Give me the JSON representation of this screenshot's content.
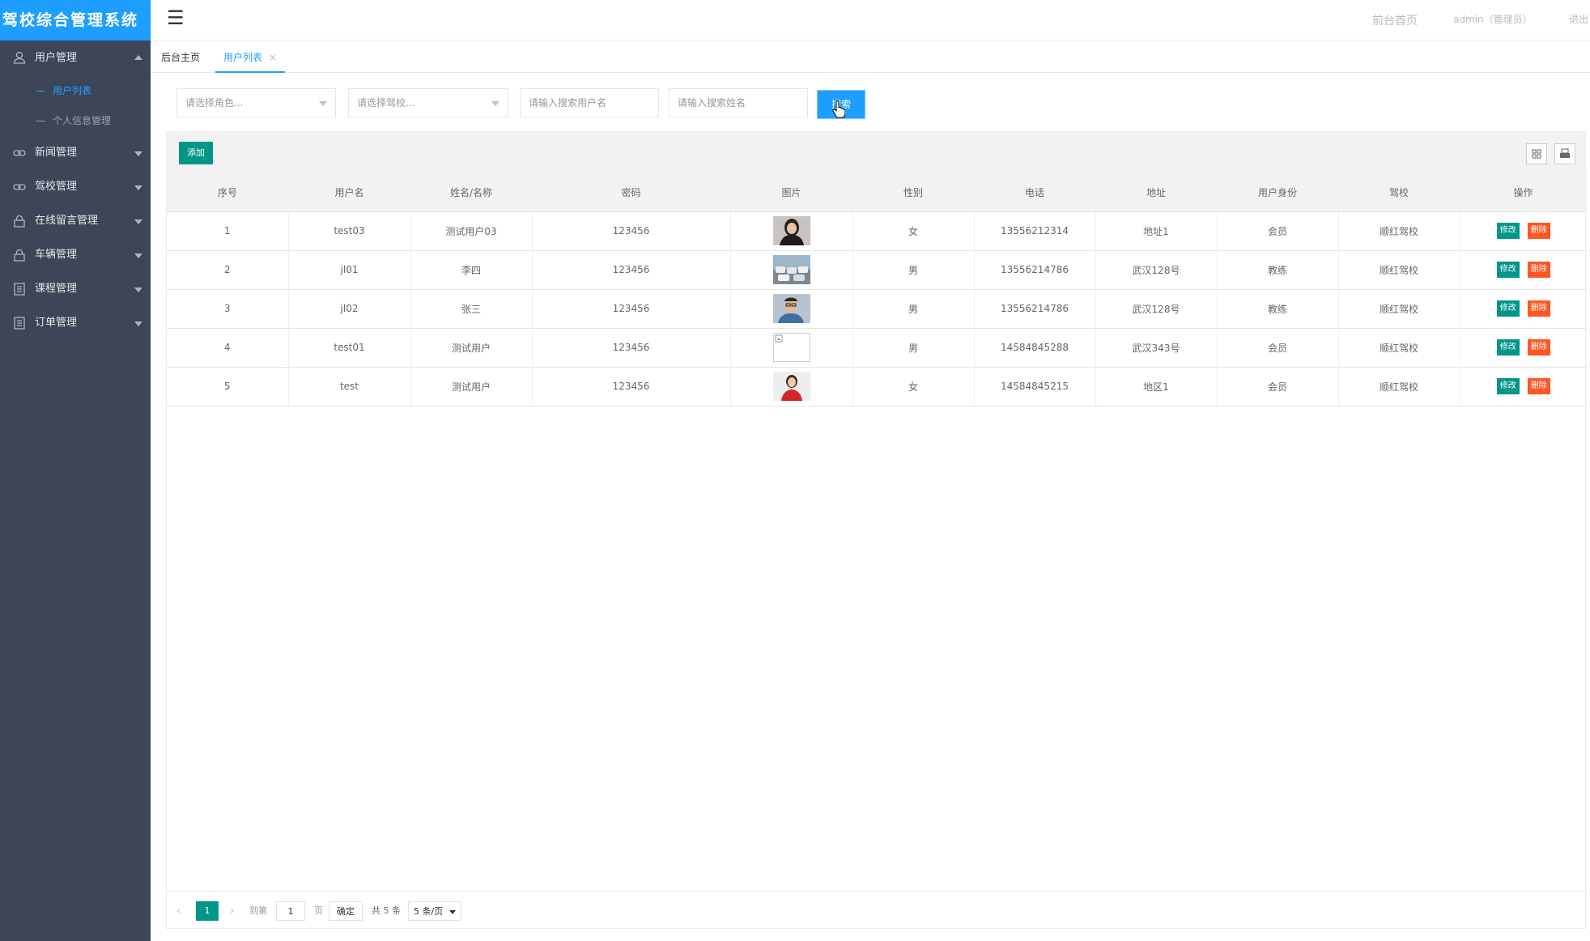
{
  "app": {
    "title": "驾校综合管理系统"
  },
  "sidebar": {
    "items": [
      {
        "label": "用户管理",
        "icon": "user-icon",
        "open": true,
        "children": [
          {
            "label": "用户列表",
            "active": true
          },
          {
            "label": "个人信息管理",
            "active": false
          }
        ]
      },
      {
        "label": "新闻管理",
        "icon": "link-icon"
      },
      {
        "label": "驾校管理",
        "icon": "link-icon"
      },
      {
        "label": "在线留言管理",
        "icon": "lock-icon"
      },
      {
        "label": "车辆管理",
        "icon": "lock-icon"
      },
      {
        "label": "课程管理",
        "icon": "document-icon"
      },
      {
        "label": "订单管理",
        "icon": "document-icon"
      }
    ]
  },
  "topbar": {
    "front_home": "前台首页",
    "user": "admin（管理员）",
    "logout": "退出"
  },
  "tabs": [
    {
      "label": "后台主页",
      "active": false
    },
    {
      "label": "用户列表",
      "active": true,
      "close": "×"
    }
  ],
  "filters": {
    "role_placeholder": "请选择角色...",
    "school_placeholder": "请选择驾校...",
    "username_placeholder": "请输入搜索用户名",
    "name_placeholder": "请输入搜索姓名",
    "search_label": "搜索"
  },
  "table": {
    "add_label": "添加",
    "columns": [
      "序号",
      "用户名",
      "姓名/名称",
      "密码",
      "图片",
      "性别",
      "电话",
      "地址",
      "用户身份",
      "驾校",
      "操作"
    ],
    "rows": [
      {
        "no": "1",
        "username": "test03",
        "name": "测试用户03",
        "password": "123456",
        "photo": "portrait-woman-dark",
        "gender": "女",
        "phone": "13556212314",
        "address": "地址1",
        "role": "会员",
        "school": "顺红驾校"
      },
      {
        "no": "2",
        "username": "jl01",
        "name": "李四",
        "password": "123456",
        "photo": "cars-lot",
        "gender": "男",
        "phone": "13556214786",
        "address": "武汉128号",
        "role": "教练",
        "school": "顺红驾校"
      },
      {
        "no": "3",
        "username": "jl02",
        "name": "张三",
        "password": "123456",
        "photo": "portrait-man-glasses",
        "gender": "男",
        "phone": "13556214786",
        "address": "武汉128号",
        "role": "教练",
        "school": "顺红驾校"
      },
      {
        "no": "4",
        "username": "test01",
        "name": "测试用户",
        "password": "123456",
        "photo": "broken-image",
        "gender": "男",
        "phone": "14584845288",
        "address": "武汉343号",
        "role": "会员",
        "school": "顺红驾校"
      },
      {
        "no": "5",
        "username": "test",
        "name": "测试用户",
        "password": "123456",
        "photo": "portrait-woman-red",
        "gender": "女",
        "phone": "14584845215",
        "address": "地区1",
        "role": "会员",
        "school": "顺红驾校"
      }
    ],
    "edit_label": "修改",
    "delete_label": "删除"
  },
  "pager": {
    "prev": "‹",
    "current": "1",
    "next": "›",
    "goto_label": "到第",
    "goto_value": "1",
    "page_unit": "页",
    "confirm": "确定",
    "total": "共 5 条",
    "page_size": "5 条/页"
  },
  "colors": {
    "accent": "#1e9fff",
    "sidebar": "#3c4658",
    "primary_btn": "#009688",
    "danger_btn": "#ff5722"
  }
}
